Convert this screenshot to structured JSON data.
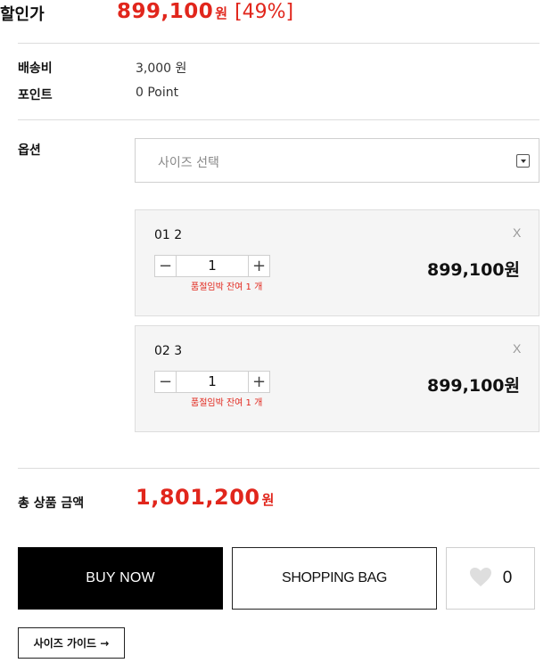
{
  "sale": {
    "label": "할인가",
    "price": "899,100",
    "currency": "원",
    "discount_rate": "[49%]"
  },
  "shipping": {
    "label": "배송비",
    "value": "3,000 원"
  },
  "points": {
    "label": "포인트",
    "value": "0 Point"
  },
  "option": {
    "label": "옵션",
    "select_placeholder": "사이즈 선택"
  },
  "selected_options": [
    {
      "name": "01 2",
      "quantity": "1",
      "stock_note": "품절임박 잔여 1 개",
      "price": "899,100원",
      "remove_label": "X"
    },
    {
      "name": "02 3",
      "quantity": "1",
      "stock_note": "품절임박 잔여 1 개",
      "price": "899,100원",
      "remove_label": "X"
    }
  ],
  "total": {
    "label": "총 상품 금액",
    "price": "1,801,200",
    "currency": "원"
  },
  "actions": {
    "buy_now": "BUY NOW",
    "shopping_bag": "SHOPPING BAG",
    "like_count": "0",
    "size_guide": "사이즈 가이드 →"
  },
  "colors": {
    "accent": "#e1261c",
    "buy_bg": "#000000",
    "card_bg": "#f5f5f5",
    "heart": "#dedede"
  }
}
